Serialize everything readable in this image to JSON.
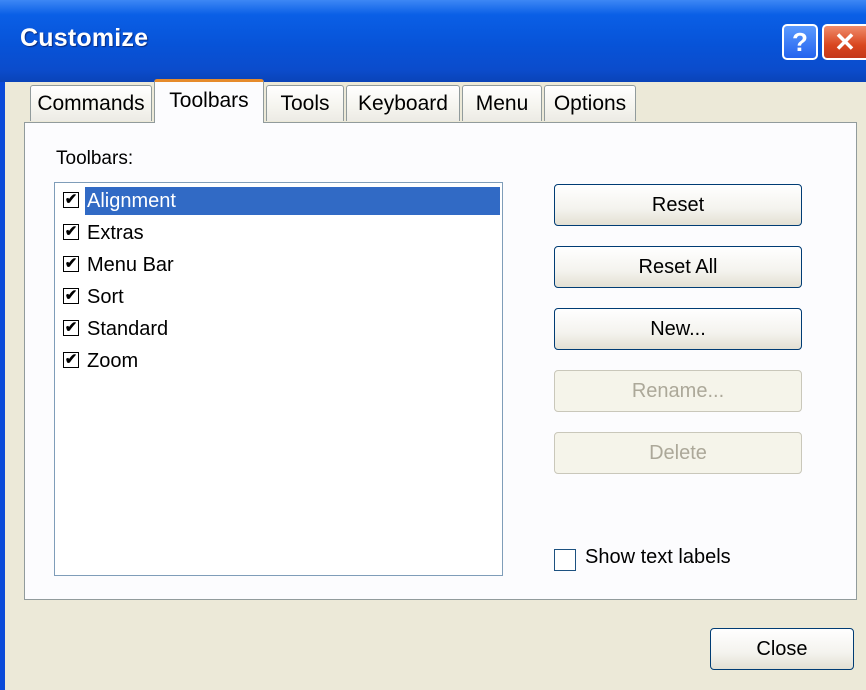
{
  "window": {
    "title": "Customize",
    "help_glyph": "?",
    "close_glyph": "✕",
    "colors": {
      "titlebar": "#0753d8",
      "face": "#ece9d8",
      "selection": "#316ac5",
      "tab_active_accent": "#e68b2c"
    }
  },
  "tabs": [
    {
      "label": "Commands",
      "active": false
    },
    {
      "label": "Toolbars",
      "active": true
    },
    {
      "label": "Tools",
      "active": false
    },
    {
      "label": "Keyboard",
      "active": false
    },
    {
      "label": "Menu",
      "active": false
    },
    {
      "label": "Options",
      "active": false
    }
  ],
  "toolbars_panel": {
    "label": "Toolbars:",
    "items": [
      {
        "label": "Alignment",
        "checked": true,
        "selected": true
      },
      {
        "label": "Extras",
        "checked": true,
        "selected": false
      },
      {
        "label": "Menu Bar",
        "checked": true,
        "selected": false
      },
      {
        "label": "Sort",
        "checked": true,
        "selected": false
      },
      {
        "label": "Standard",
        "checked": true,
        "selected": false
      },
      {
        "label": "Zoom",
        "checked": true,
        "selected": false
      }
    ],
    "check_glyph": "✔"
  },
  "buttons": {
    "reset": {
      "label": "Reset",
      "enabled": true
    },
    "reset_all": {
      "label": "Reset All",
      "enabled": true
    },
    "new": {
      "label": "New...",
      "enabled": true
    },
    "rename": {
      "label": "Rename...",
      "enabled": false
    },
    "delete": {
      "label": "Delete",
      "enabled": false
    }
  },
  "show_text_labels": {
    "label": "Show text labels",
    "checked": false
  },
  "footer": {
    "close_label": "Close"
  }
}
